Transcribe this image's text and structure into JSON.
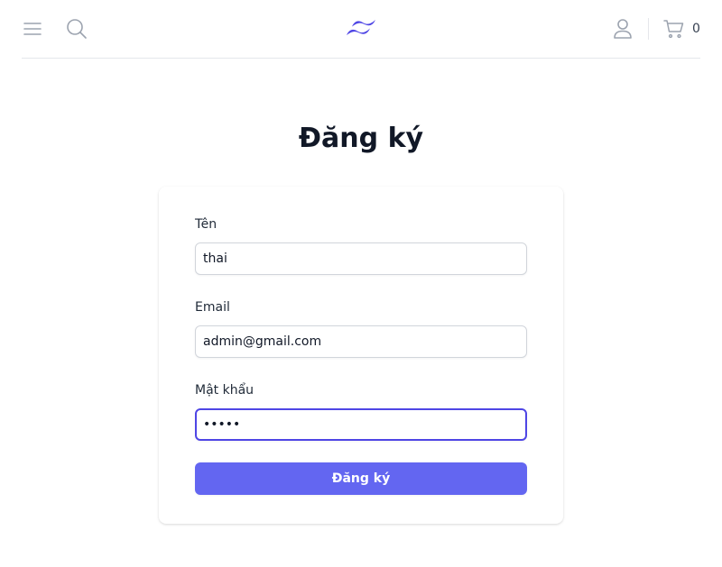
{
  "header": {
    "menu_icon": "hamburger-menu-icon",
    "search_icon": "search-icon",
    "logo_icon": "wave-logo-icon",
    "account_icon": "user-icon",
    "cart_icon": "shopping-cart-icon",
    "cart_count": "0"
  },
  "page": {
    "title": "Đăng ký"
  },
  "form": {
    "name_label": "Tên",
    "name_value": "thai",
    "email_label": "Email",
    "email_value": "admin@gmail.com",
    "password_label": "Mật khẩu",
    "password_value": "12345",
    "submit_label": "Đăng ký"
  },
  "colors": {
    "accent": "#6366f1",
    "focus_ring": "#4f46e5",
    "icon_gray": "#9ca3af",
    "border": "#d1d5db",
    "divider": "#e5e7eb"
  }
}
